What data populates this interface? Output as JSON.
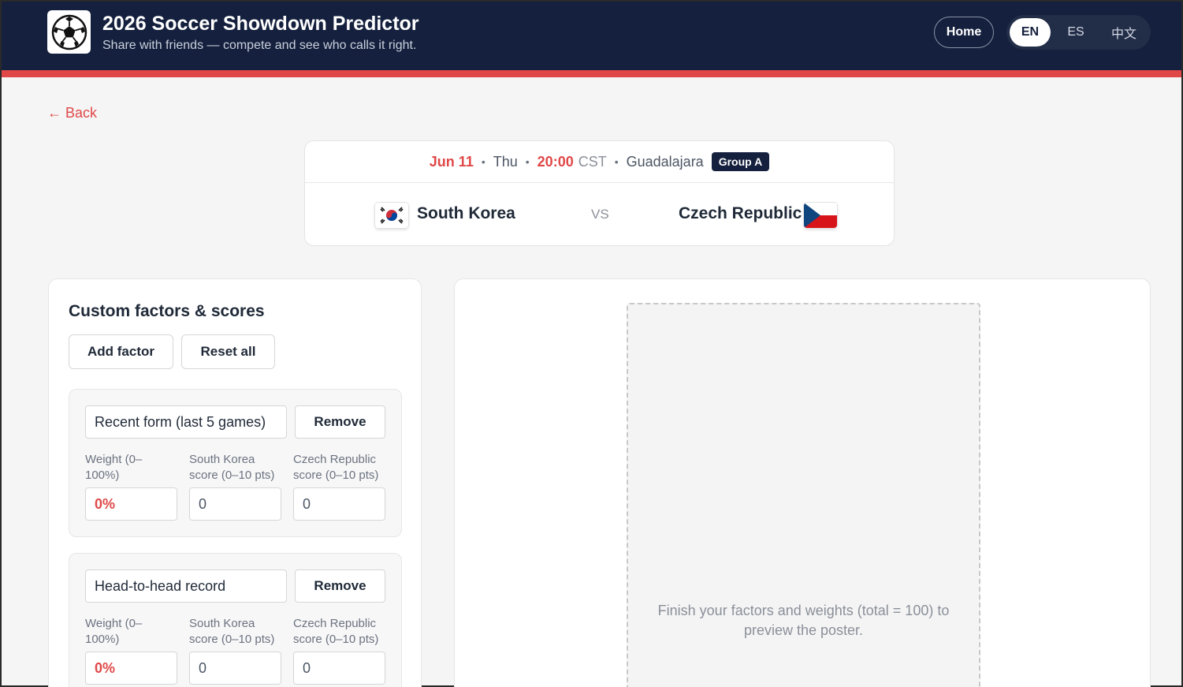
{
  "header": {
    "title": "2026 Soccer Showdown Predictor",
    "subtitle": "Share with friends — compete and see who calls it right.",
    "home_label": "Home",
    "languages": [
      "EN",
      "ES",
      "中文"
    ],
    "active_language": "EN"
  },
  "nav": {
    "back_label": "← Back"
  },
  "match": {
    "date": "Jun 11",
    "weekday": "Thu",
    "time": "20:00",
    "timezone": "CST",
    "venue": "Guadalajara",
    "group": "Group A",
    "home_team": "South Korea",
    "away_team": "Czech Republic",
    "vs_label": "VS"
  },
  "factors_panel": {
    "title": "Custom factors & scores",
    "add_label": "Add factor",
    "reset_label": "Reset all",
    "remove_label": "Remove",
    "weight_label": "Weight (0–100%)",
    "home_score_label": "South Korea score (0–10 pts)",
    "away_score_label": "Czech Republic score (0–10 pts)",
    "factors": [
      {
        "name": "Recent form (last 5 games)",
        "weight": "0%",
        "home_score": "0",
        "away_score": "0"
      },
      {
        "name": "Head-to-head record",
        "weight": "0%",
        "home_score": "0",
        "away_score": "0"
      }
    ]
  },
  "poster": {
    "hint": "Finish your factors and weights (total = 100) to preview the poster."
  },
  "colors": {
    "header_bg": "#14203d",
    "accent": "#e04848"
  }
}
